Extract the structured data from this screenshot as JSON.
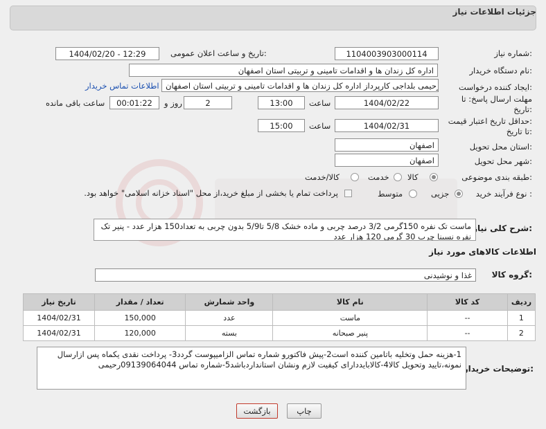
{
  "header": {
    "title": "جزئیات اطلاعات نیاز"
  },
  "form": {
    "need_number_label": "شماره نیاز:",
    "need_number": "1104003903000114",
    "announce_label": "تاریخ و ساعت اعلان عمومی:",
    "announce_value": "1404/02/20 - 12:29",
    "buyer_org_label": "نام دستگاه خریدار:",
    "buyer_org": "اداره کل زندان ها و اقدامات تامینی و تربیتی استان اصفهان",
    "requester_label": "ایجاد کننده درخواست:",
    "requester": "مجتبی رحیمی بلداجی کارپرداز اداره کل زندان ها و اقدامات تامینی و تربیتی استان اصفهان",
    "contact_link": "اطلاعات تماس خریدار",
    "deadline_label_1": "مهلت ارسال پاسخ: تا",
    "deadline_label_2": "تاریخ:",
    "deadline_date": "1404/02/22",
    "time_label": "ساعت",
    "deadline_time": "13:00",
    "days_value": "2",
    "days_label": "روز و",
    "remaining_time": "00:01:22",
    "remaining_label": "ساعت باقی مانده",
    "validity_label_1": "حداقل تاریخ اعتبار قیمت:",
    "validity_label_2": "تا تاریخ:",
    "validity_date": "1404/02/31",
    "validity_time": "15:00",
    "province_label": "استان محل تحویل:",
    "province": "اصفهان",
    "city_label": "شهر محل تحویل:",
    "city": "اصفهان",
    "category_label": "طبقه بندی موضوعی:",
    "category_options": [
      "کالا",
      "خدمت",
      "کالا/خدمت"
    ],
    "category_selected": "کالا",
    "process_label": "نوع فرآیند خرید :",
    "process_options": [
      "جزیی",
      "متوسط"
    ],
    "process_selected": "جزیی",
    "payment_note": "پرداخت تمام یا بخشی از مبلغ خرید،از محل \"اسناد خزانه اسلامی\" خواهد بود."
  },
  "summary": {
    "label": "شرح کلی نیاز:",
    "text": "ماست تک نفره 150گرمی 3/2 درصد چربی و ماده خشک 5/8 تا5/9 بدون چربی به تعداد150 هزار عدد - پنیر تک نفره نسینا چرب 30 گرمی 120 هزار عدد"
  },
  "goods_section": {
    "title": "اطلاعات کالاهای مورد نیاز",
    "group_label": "گروه کالا:",
    "group_value": "غذا و نوشیدنی"
  },
  "table": {
    "headers": [
      "ردیف",
      "کد کالا",
      "نام کالا",
      "واحد شمارش",
      "تعداد / مقدار",
      "تاریخ نیاز"
    ],
    "rows": [
      [
        "1",
        "--",
        "ماست",
        "عدد",
        "150,000",
        "1404/02/31"
      ],
      [
        "2",
        "--",
        "پنیر صبحانه",
        "بسته",
        "120,000",
        "1404/02/31"
      ]
    ]
  },
  "notes": {
    "label": "توضیحات خریدار:",
    "text": "1-هزینه حمل وتخلیه باتامین کننده است2-پیش فاکتورو شماره تماس الزامیپوست گردد3- پرداخت نقدی یکماه  پس ازارسال نمونه،تایید وتحویل کالا4-کالابایددارای کیفیت لازم ونشان استانداردباشد5-شماره تماس 09139064044رحیمی"
  },
  "buttons": {
    "print": "چاپ",
    "back": "بازگشت"
  },
  "colors": {
    "panel_bg": "#d9d9d9",
    "link": "#1a4fb0",
    "back_button_border": "#c0392b"
  }
}
